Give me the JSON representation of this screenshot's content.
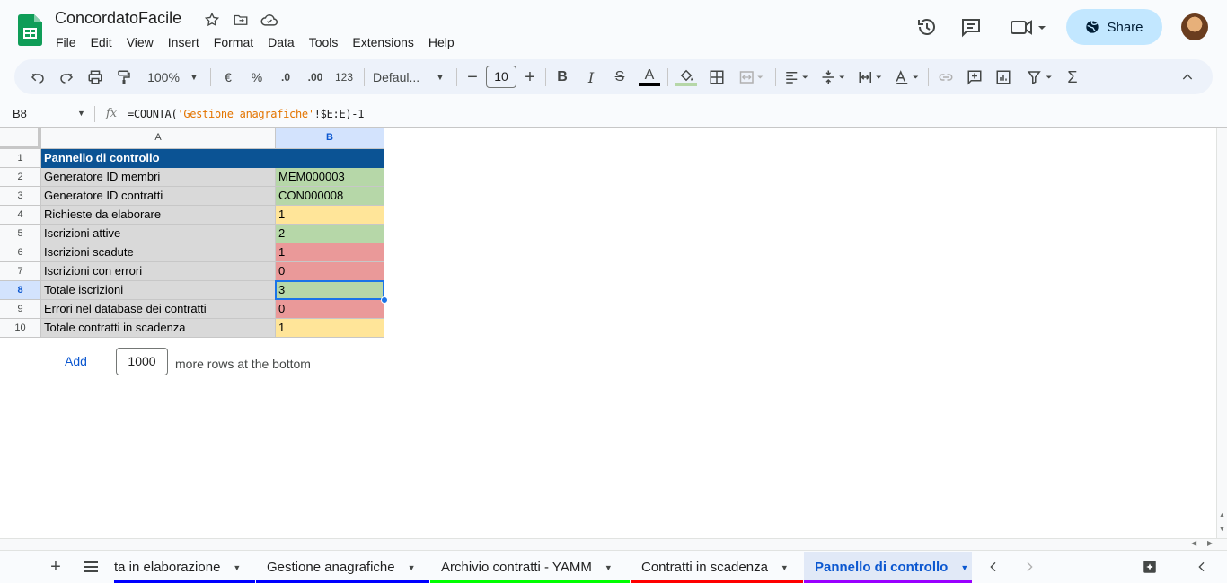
{
  "app": {
    "doc_title": "ConcordatoFacile",
    "menu": [
      "File",
      "Edit",
      "View",
      "Insert",
      "Format",
      "Data",
      "Tools",
      "Extensions",
      "Help"
    ],
    "share_label": "Share"
  },
  "toolbar": {
    "zoom": "100%",
    "currency": "€",
    "percent": "%",
    "decrease_decimals": ".0",
    "increase_decimals": ".00",
    "more_formats": "123",
    "font": "Defaul...",
    "font_size": "10"
  },
  "formula_bar": {
    "name_box": "B8",
    "fx": "fx",
    "formula_prefix": "=COUNTA(",
    "formula_sheet": "'Gestione anagrafiche'",
    "formula_range": "!$E:E",
    "formula_suffix": ")-1"
  },
  "grid": {
    "columns": [
      "A",
      "B"
    ],
    "row_numbers": [
      "1",
      "2",
      "3",
      "4",
      "5",
      "6",
      "7",
      "8",
      "9",
      "10"
    ],
    "header": "Pannello di controllo",
    "rows": [
      {
        "label": "Generatore ID membri",
        "value": "MEM000003",
        "color": "#b6d7a8"
      },
      {
        "label": "Generatore ID contratti",
        "value": "CON000008",
        "color": "#b6d7a8"
      },
      {
        "label": "Richieste da elaborare",
        "value": "1",
        "color": "#ffe599"
      },
      {
        "label": "Iscrizioni attive",
        "value": "2",
        "color": "#b6d7a8"
      },
      {
        "label": "Iscrizioni scadute",
        "value": "1",
        "color": "#ea9999"
      },
      {
        "label": "Iscrizioni con errori",
        "value": "0",
        "color": "#ea9999"
      },
      {
        "label": "Totale iscrizioni",
        "value": "3",
        "color": "#b6d7a8"
      },
      {
        "label": "Errori nel database dei contratti",
        "value": "0",
        "color": "#ea9999"
      },
      {
        "label": "Totale contratti in scadenza",
        "value": "1",
        "color": "#ffe599"
      }
    ],
    "selected_cell": "B8"
  },
  "add_rows": {
    "button": "Add",
    "count": "1000",
    "suffix": "more rows at the bottom"
  },
  "sheet_tabs": [
    {
      "label": "ta in elaborazione",
      "color": "#0000ff",
      "active": false
    },
    {
      "label": "Gestione anagrafiche",
      "color": "#0000ff",
      "active": false
    },
    {
      "label": "Archivio contratti - YAMM",
      "color": "#00ff00",
      "active": false
    },
    {
      "label": "Contratti in scadenza",
      "color": "#ff0000",
      "active": false
    },
    {
      "label": "Pannello di controllo",
      "color": "#9900ff",
      "active": true
    }
  ],
  "icons": [
    "sheets-logo-icon",
    "star-icon",
    "move-folder-icon",
    "cloud-saved-icon",
    "history-icon",
    "comments-icon",
    "meet-icon",
    "globe-icon",
    "undo-icon",
    "redo-icon",
    "print-icon",
    "paint-format-icon",
    "bold-icon",
    "italic-icon",
    "strikethrough-icon",
    "text-color-icon",
    "fill-color-icon",
    "borders-icon",
    "merge-icon",
    "align-icon",
    "valign-icon",
    "wrap-icon",
    "rotate-icon",
    "link-icon",
    "comment-icon",
    "chart-icon",
    "filter-icon",
    "functions-icon",
    "collapse-icon",
    "add-sheet-icon",
    "all-sheets-icon",
    "explore-icon"
  ]
}
